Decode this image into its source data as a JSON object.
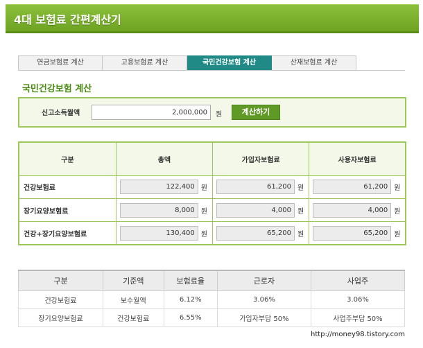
{
  "header": {
    "title": "4대 보험료 간편계산기"
  },
  "tabs": [
    {
      "label": "연금보험료 계산",
      "active": false
    },
    {
      "label": "고용보험료 계산",
      "active": false
    },
    {
      "label": "국민건강보험 계산",
      "active": true
    },
    {
      "label": "산재보험료 계산",
      "active": false
    }
  ],
  "section_title": "국민건강보험 계산",
  "income": {
    "label": "신고소득월액",
    "value": "2,000,000",
    "unit": "원",
    "button_label": "계산하기"
  },
  "result_table": {
    "headers": [
      "구분",
      "총액",
      "가입자보험료",
      "사용자보험료"
    ],
    "unit": "원",
    "rows": [
      {
        "label": "건강보험료",
        "values": [
          "122,400",
          "61,200",
          "61,200"
        ]
      },
      {
        "label": "장기요양보험료",
        "values": [
          "8,000",
          "4,000",
          "4,000"
        ]
      },
      {
        "label": "건강+장기요양보험료",
        "values": [
          "130,400",
          "65,200",
          "65,200"
        ]
      }
    ]
  },
  "rate_table": {
    "headers": [
      "구분",
      "기준액",
      "보험료율",
      "근로자",
      "사업주"
    ],
    "rows": [
      [
        "건강보험료",
        "보수월액",
        "6.12%",
        "3.06%",
        "3.06%"
      ],
      [
        "장기요양보험료",
        "건강보험료",
        "6.55%",
        "가입자부담 50%",
        "사업주부담 50%"
      ]
    ]
  },
  "watermark": "http://money98.tistory.com",
  "colors": {
    "accent_green": "#6da321",
    "active_tab": "#1f8a86",
    "box_border": "#9cc85a"
  }
}
